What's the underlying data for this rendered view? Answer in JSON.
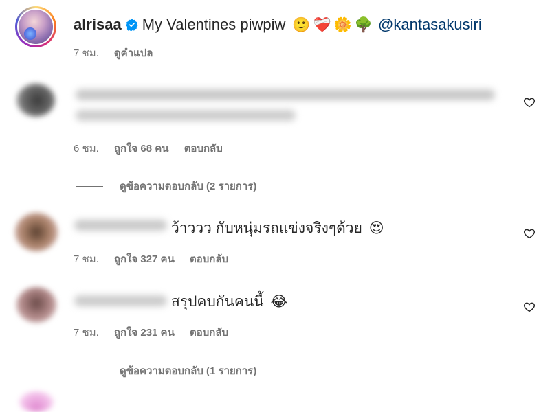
{
  "post": {
    "username": "alrisaa",
    "caption_text": "My Valentines piwpiw",
    "caption_emojis": [
      "🙂",
      "❤️‍🩹",
      "🌼",
      "🌳"
    ],
    "mention": "@kantasakusiri",
    "time": "7 ชม.",
    "translate_label": "ดูคำแปล"
  },
  "comments": [
    {
      "text": "",
      "time": "6 ชม.",
      "likes": "ถูกใจ 68 คน",
      "reply_label": "ตอบกลับ",
      "view_replies": "ดูข้อความตอบกลับ (2 รายการ)"
    },
    {
      "text": "ว้าววว กับหนุ่มรถแข่งจริงๆด้วย",
      "emoji": "😍",
      "time": "7 ชม.",
      "likes": "ถูกใจ 327 คน",
      "reply_label": "ตอบกลับ"
    },
    {
      "text": "สรุปคบกันคนนี้",
      "emoji": "😂",
      "time": "7 ชม.",
      "likes": "ถูกใจ 231 คน",
      "reply_label": "ตอบกลับ",
      "view_replies": "ดูข้อความตอบกลับ (1 รายการ)"
    }
  ],
  "colors": {
    "link": "#00376b",
    "secondary_text": "#737373",
    "verified_badge": "#0095f6"
  }
}
